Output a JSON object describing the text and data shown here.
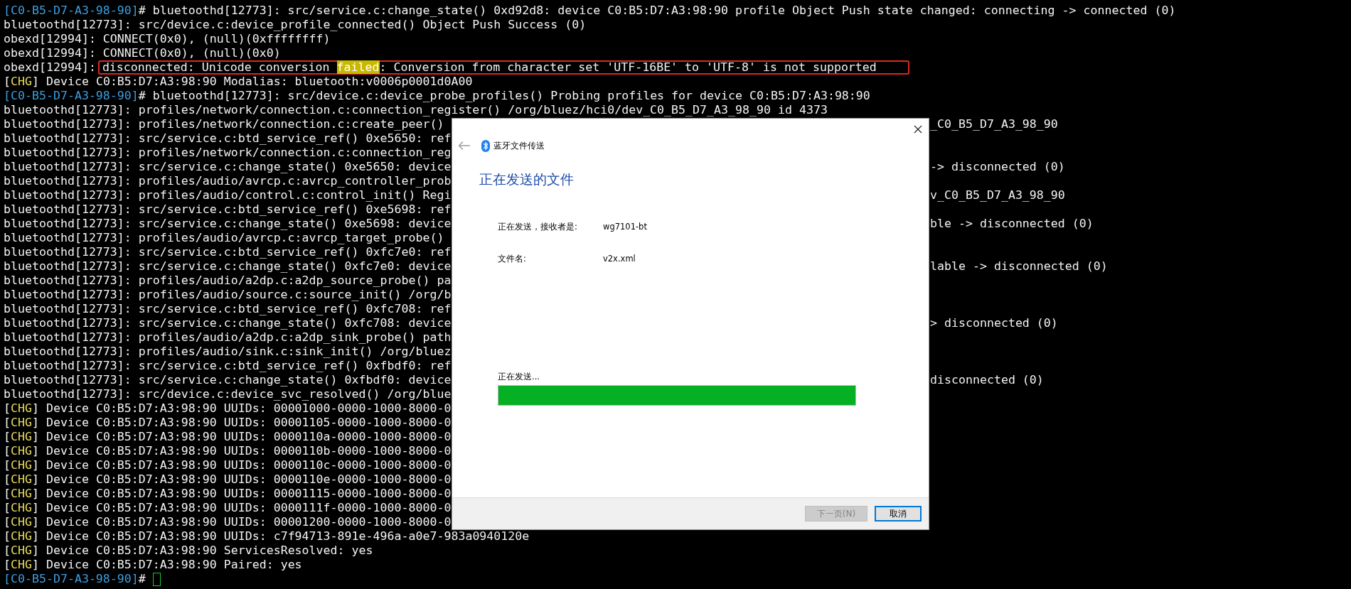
{
  "terminal": {
    "lines": [
      {
        "segments": [
          {
            "text": "[C0-B5-D7-A3-98-90]",
            "kind": "prompt"
          },
          {
            "text": "# bluetoothd[12773]: src/service.c:change_state() 0xd92d8: device C0:B5:D7:A3:98:90 profile Object Push state changed: connecting -> connected (0)",
            "kind": "text"
          }
        ]
      },
      {
        "segments": [
          {
            "text": "bluetoothd[12773]: src/device.c:device_profile_connected() Object Push Success (0)",
            "kind": "text"
          }
        ]
      },
      {
        "segments": [
          {
            "text": "obexd[12994]: CONNECT(0x0), (null)(0xffffffff)",
            "kind": "text"
          }
        ]
      },
      {
        "segments": [
          {
            "text": "obexd[12994]: CONNECT(0x0), (null)(0x0)",
            "kind": "text"
          }
        ]
      },
      {
        "segments": [
          {
            "text": "obexd[12994]:",
            "kind": "text"
          },
          {
            "kind": "boxed",
            "parts": [
              {
                "text": "disconnected: Unicode conversion ",
                "kind": "text"
              },
              {
                "text": "failed",
                "kind": "match"
              },
              {
                "text": ": Conversion from character set 'UTF-16BE' to 'UTF-8' is not supported",
                "kind": "text"
              }
            ]
          }
        ]
      },
      {
        "segments": [
          {
            "text": "[",
            "kind": "text"
          },
          {
            "text": "CHG",
            "kind": "tag"
          },
          {
            "text": "] Device C0:B5:D7:A3:98:90 Modalias: bluetooth:v0006p0001d0A00",
            "kind": "text"
          }
        ]
      },
      {
        "segments": [
          {
            "text": "[C0-B5-D7-A3-98-90]",
            "kind": "prompt"
          },
          {
            "text": "# bluetoothd[12773]: src/device.c:device_probe_profiles() Probing profiles for device C0:B5:D7:A3:98:90",
            "kind": "text"
          }
        ]
      },
      {
        "segments": [
          {
            "text": "bluetoothd[12773]: profiles/network/connection.c:connection_register() /org/bluez/hci0/dev_C0_B5_D7_A3_98_90 id 4373",
            "kind": "text"
          }
        ]
      },
      {
        "segments": [
          {
            "text": "bluetoothd[12773]: profiles/network/connection.c:create_peer()",
            "kind": "text"
          }
        ],
        "right": "_C0_B5_D7_A3_98_90"
      },
      {
        "segments": [
          {
            "text": "bluetoothd[12773]: src/service.c:btd_service_ref() 0xe5650: ref",
            "kind": "text"
          }
        ]
      },
      {
        "segments": [
          {
            "text": "bluetoothd[12773]: profiles/network/connection.c:connection_reg",
            "kind": "text"
          }
        ]
      },
      {
        "segments": [
          {
            "text": "bluetoothd[12773]: src/service.c:change_state() 0xe5650: device",
            "kind": "text"
          }
        ],
        "right": "-> disconnected (0)"
      },
      {
        "segments": [
          {
            "text": "bluetoothd[12773]: profiles/audio/avrcp.c:avrcp_controller_prob",
            "kind": "text"
          }
        ]
      },
      {
        "segments": [
          {
            "text": "bluetoothd[12773]: profiles/audio/control.c:control_init() Regi",
            "kind": "text"
          }
        ],
        "right": "v_C0_B5_D7_A3_98_90"
      },
      {
        "segments": [
          {
            "text": "bluetoothd[12773]: src/service.c:btd_service_ref() 0xe5698: ref",
            "kind": "text"
          }
        ]
      },
      {
        "segments": [
          {
            "text": "bluetoothd[12773]: src/service.c:change_state() 0xe5698: device",
            "kind": "text"
          }
        ],
        "right": "ble -> disconnected (0)"
      },
      {
        "segments": [
          {
            "text": "bluetoothd[12773]: profiles/audio/avrcp.c:avrcp_target_probe()",
            "kind": "text"
          }
        ]
      },
      {
        "segments": [
          {
            "text": "bluetoothd[12773]: src/service.c:btd_service_ref() 0xfc7e0: ref",
            "kind": "text"
          }
        ]
      },
      {
        "segments": [
          {
            "text": "bluetoothd[12773]: src/service.c:change_state() 0xfc7e0: device",
            "kind": "text"
          }
        ],
        "right": "lable -> disconnected (0)"
      },
      {
        "segments": [
          {
            "text": "bluetoothd[12773]: profiles/audio/a2dp.c:a2dp_source_probe() pa",
            "kind": "text"
          }
        ]
      },
      {
        "segments": [
          {
            "text": "bluetoothd[12773]: profiles/audio/source.c:source_init() /org/b",
            "kind": "text"
          }
        ]
      },
      {
        "segments": [
          {
            "text": "bluetoothd[12773]: src/service.c:btd_service_ref() 0xfc708: ref",
            "kind": "text"
          }
        ]
      },
      {
        "segments": [
          {
            "text": "bluetoothd[12773]: src/service.c:change_state() 0xfc708: device",
            "kind": "text"
          }
        ],
        "right": "> disconnected (0)"
      },
      {
        "segments": [
          {
            "text": "bluetoothd[12773]: profiles/audio/a2dp.c:a2dp_sink_probe() path",
            "kind": "text"
          }
        ]
      },
      {
        "segments": [
          {
            "text": "bluetoothd[12773]: profiles/audio/sink.c:sink_init() /org/bluez",
            "kind": "text"
          }
        ]
      },
      {
        "segments": [
          {
            "text": "bluetoothd[12773]: src/service.c:btd_service_ref() 0xfbdf0: ref",
            "kind": "text"
          }
        ]
      },
      {
        "segments": [
          {
            "text": "bluetoothd[12773]: src/service.c:change_state() 0xfbdf0: device",
            "kind": "text"
          }
        ],
        "right": "disconnected (0)"
      },
      {
        "segments": [
          {
            "text": "bluetoothd[12773]: src/device.c:device_svc_resolved() /org/blue",
            "kind": "text"
          }
        ]
      },
      {
        "segments": [
          {
            "text": "[",
            "kind": "text"
          },
          {
            "text": "CHG",
            "kind": "tag"
          },
          {
            "text": "] Device C0:B5:D7:A3:98:90 UUIDs: 00001000-0000-1000-8000-0",
            "kind": "text"
          }
        ]
      },
      {
        "segments": [
          {
            "text": "[",
            "kind": "text"
          },
          {
            "text": "CHG",
            "kind": "tag"
          },
          {
            "text": "] Device C0:B5:D7:A3:98:90 UUIDs: 00001105-0000-1000-8000-0",
            "kind": "text"
          }
        ]
      },
      {
        "segments": [
          {
            "text": "[",
            "kind": "text"
          },
          {
            "text": "CHG",
            "kind": "tag"
          },
          {
            "text": "] Device C0:B5:D7:A3:98:90 UUIDs: 0000110a-0000-1000-8000-0",
            "kind": "text"
          }
        ]
      },
      {
        "segments": [
          {
            "text": "[",
            "kind": "text"
          },
          {
            "text": "CHG",
            "kind": "tag"
          },
          {
            "text": "] Device C0:B5:D7:A3:98:90 UUIDs: 0000110b-0000-1000-8000-0",
            "kind": "text"
          }
        ]
      },
      {
        "segments": [
          {
            "text": "[",
            "kind": "text"
          },
          {
            "text": "CHG",
            "kind": "tag"
          },
          {
            "text": "] Device C0:B5:D7:A3:98:90 UUIDs: 0000110c-0000-1000-8000-0",
            "kind": "text"
          }
        ]
      },
      {
        "segments": [
          {
            "text": "[",
            "kind": "text"
          },
          {
            "text": "CHG",
            "kind": "tag"
          },
          {
            "text": "] Device C0:B5:D7:A3:98:90 UUIDs: 0000110e-0000-1000-8000-0",
            "kind": "text"
          }
        ]
      },
      {
        "segments": [
          {
            "text": "[",
            "kind": "text"
          },
          {
            "text": "CHG",
            "kind": "tag"
          },
          {
            "text": "] Device C0:B5:D7:A3:98:90 UUIDs: 00001115-0000-1000-8000-0",
            "kind": "text"
          }
        ]
      },
      {
        "segments": [
          {
            "text": "[",
            "kind": "text"
          },
          {
            "text": "CHG",
            "kind": "tag"
          },
          {
            "text": "] Device C0:B5:D7:A3:98:90 UUIDs: 0000111f-0000-1000-8000-0",
            "kind": "text"
          }
        ]
      },
      {
        "segments": [
          {
            "text": "[",
            "kind": "text"
          },
          {
            "text": "CHG",
            "kind": "tag"
          },
          {
            "text": "] Device C0:B5:D7:A3:98:90 UUIDs: 00001200-0000-1000-8000-0",
            "kind": "text"
          }
        ]
      },
      {
        "segments": [
          {
            "text": "[",
            "kind": "text"
          },
          {
            "text": "CHG",
            "kind": "tag"
          },
          {
            "text": "] Device C0:B5:D7:A3:98:90 UUIDs: c7f94713-891e-496a-a0e7-983a0940120e",
            "kind": "text"
          }
        ]
      },
      {
        "segments": [
          {
            "text": "[",
            "kind": "text"
          },
          {
            "text": "CHG",
            "kind": "tag"
          },
          {
            "text": "] Device C0:B5:D7:A3:98:90 ServicesResolved: yes",
            "kind": "text"
          }
        ]
      },
      {
        "segments": [
          {
            "text": "[",
            "kind": "text"
          },
          {
            "text": "CHG",
            "kind": "tag"
          },
          {
            "text": "] Device C0:B5:D7:A3:98:90 Paired: yes",
            "kind": "text"
          }
        ]
      },
      {
        "segments": [
          {
            "text": "[C0-B5-D7-A3-98-90]",
            "kind": "prompt"
          },
          {
            "text": "#",
            "kind": "text"
          },
          {
            "kind": "cursor"
          }
        ]
      }
    ]
  },
  "dialog": {
    "title": "蓝牙文件传送",
    "heading": "正在发送的文件",
    "fields": [
      {
        "label": "正在发送，接收者是:",
        "value": "wg7101-bt"
      },
      {
        "label": "文件名:",
        "value": "v2x.xml"
      }
    ],
    "status": "正在发送...",
    "progress": {
      "level": 1.0
    },
    "buttons": [
      {
        "label": "下一页(N)",
        "disabled": true,
        "focused": false
      },
      {
        "label": "取消",
        "disabled": false,
        "focused": true
      }
    ]
  }
}
